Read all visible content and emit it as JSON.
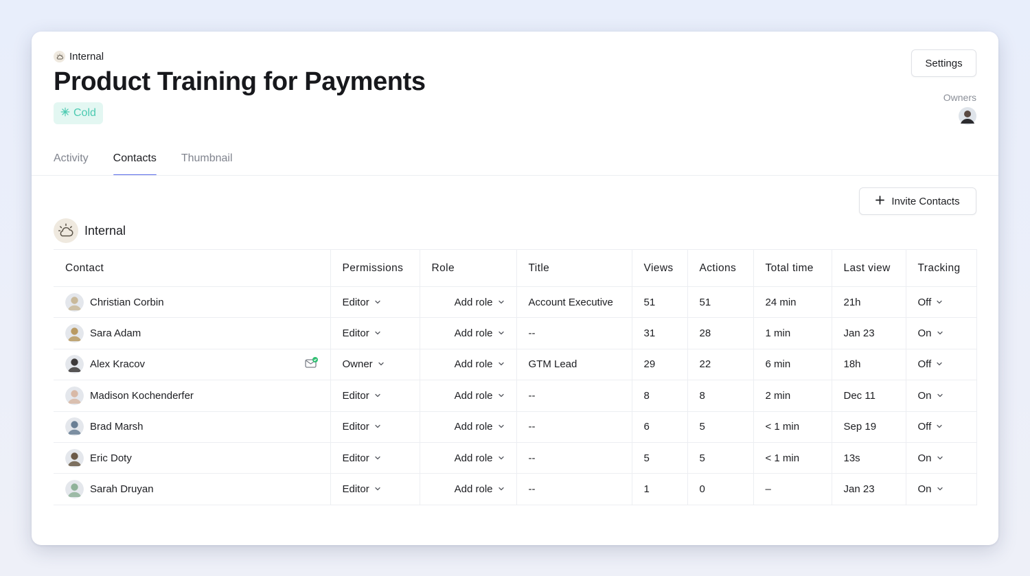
{
  "header": {
    "breadcrumb": "Internal",
    "title": "Product Training for Payments",
    "badge": "Cold",
    "badge_icon": "snowflake-icon"
  },
  "settings_label": "Settings",
  "owners_label": "Owners",
  "tabs": [
    {
      "label": "Activity",
      "active": false
    },
    {
      "label": "Contacts",
      "active": true
    },
    {
      "label": "Thumbnail",
      "active": false
    }
  ],
  "invite_label": "Invite Contacts",
  "section": {
    "title": "Internal",
    "icon": "sun-cloud-icon"
  },
  "table": {
    "headers": [
      "Contact",
      "Permissions",
      "Role",
      "Title",
      "Views",
      "Actions",
      "Total time",
      "Last view",
      "Tracking"
    ],
    "rows": [
      {
        "name": "Christian Corbin",
        "permission": "Editor",
        "role": "Add role",
        "title": "Account Executive",
        "views": "51",
        "actions": "51",
        "total_time": "24 min",
        "last_view": "21h",
        "tracking": "Off",
        "avatar_color": "#c9b99a",
        "mail": false
      },
      {
        "name": "Sara Adam",
        "permission": "Editor",
        "role": "Add role",
        "title": "--",
        "views": "31",
        "actions": "28",
        "total_time": "1 min",
        "last_view": "Jan 23",
        "tracking": "On",
        "avatar_color": "#b99a63",
        "mail": false
      },
      {
        "name": "Alex Kracov",
        "permission": "Owner",
        "role": "Add role",
        "title": "GTM Lead",
        "views": "29",
        "actions": "22",
        "total_time": "6 min",
        "last_view": "18h",
        "tracking": "Off",
        "avatar_color": "#3d3a3a",
        "mail": true
      },
      {
        "name": "Madison Kochenderfer",
        "permission": "Editor",
        "role": "Add role",
        "title": "--",
        "views": "8",
        "actions": "8",
        "total_time": "2 min",
        "last_view": "Dec 11",
        "tracking": "On",
        "avatar_color": "#d8b9a6",
        "mail": false
      },
      {
        "name": "Brad Marsh",
        "permission": "Editor",
        "role": "Add role",
        "title": "--",
        "views": "6",
        "actions": "5",
        "total_time": "< 1 min",
        "last_view": "Sep 19",
        "tracking": "Off",
        "avatar_color": "#6a7f95",
        "mail": false
      },
      {
        "name": "Eric Doty",
        "permission": "Editor",
        "role": "Add role",
        "title": "--",
        "views": "5",
        "actions": "5",
        "total_time": "< 1 min",
        "last_view": "13s",
        "tracking": "On",
        "avatar_color": "#6b5a48",
        "mail": false
      },
      {
        "name": "Sarah Druyan",
        "permission": "Editor",
        "role": "Add role",
        "title": "--",
        "views": "1",
        "actions": "0",
        "total_time": "–",
        "last_view": "Jan 23",
        "tracking": "On",
        "avatar_color": "#8fb29a",
        "mail": false
      }
    ]
  },
  "colors": {
    "accent": "#5568e8",
    "badge_bg": "#e3f7f2",
    "badge_text": "#4ccab1",
    "mail_check": "#2fbf71"
  }
}
